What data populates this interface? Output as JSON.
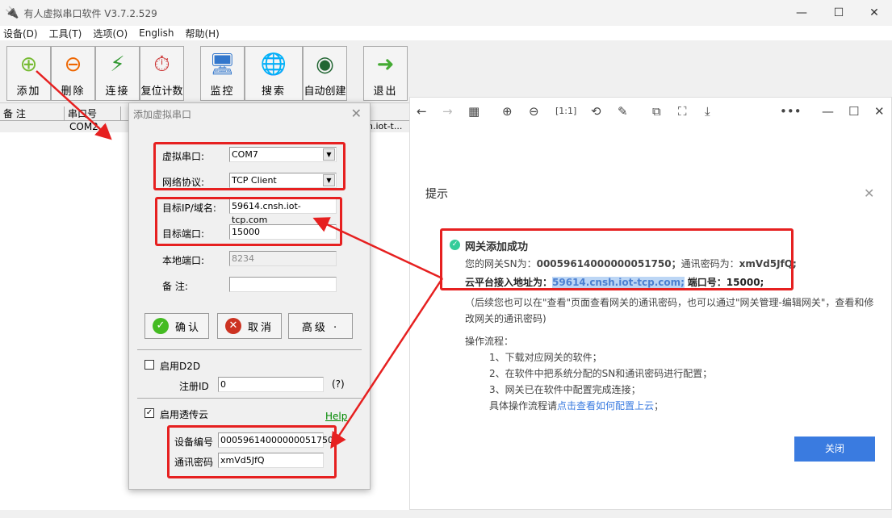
{
  "app": {
    "title": "有人虚拟串口软件 V3.7.2.529",
    "menu": [
      "设备(D)",
      "工具(T)",
      "选项(O)",
      "English",
      "帮助(H)"
    ],
    "toolbar": [
      "添加",
      "删除",
      "连接",
      "复位计数",
      "监控",
      "搜索",
      "自动创建",
      "退出"
    ],
    "list_headers": [
      "备 注",
      "串口号"
    ],
    "row": {
      "port": "COM2",
      "host": "n.iot-t..."
    }
  },
  "dialog": {
    "title": "添加虚拟串口",
    "virtual_port_label": "虚拟串口:",
    "virtual_port": "COM7",
    "protocol_label": "网络协议:",
    "protocol": "TCP Client",
    "target_ip_label": "目标IP/域名:",
    "target_ip": "59614.cnsh.iot-tcp.com",
    "target_port_label": "目标端口:",
    "target_port": "15000",
    "local_port_label": "本地端口:",
    "local_port": "8234",
    "remark_label": "备 注:",
    "remark": "",
    "ok": "确认",
    "cancel": "取消",
    "advanced": "高级 ·",
    "d2d_label": "启用D2D",
    "d2d_checked": false,
    "reg_id_label": "注册ID",
    "reg_id": "0",
    "reg_help": "(?)",
    "cloud_label": "启用透传云",
    "cloud_checked": true,
    "help": "Help",
    "device_id_label": "设备编号",
    "device_id": "00059614000000051750",
    "password_label": "通讯密码",
    "password": "xmVd5JfQ"
  },
  "viewer": {
    "tip_title": "提示",
    "success": "网关添加成功",
    "line1_a": "您的网关SN为：",
    "line1_sn": "00059614000000051750；",
    "line1_b": "通讯密码为：",
    "line1_pw": "xmVd5JfQ;",
    "line2_a": "云平台接入地址为：",
    "line2_host": "59614.cnsh.iot-tcp.com;",
    "line2_b": "端口号：15000;",
    "note1": "（后续您也可以在\"查看\"页面查看网关的通讯密码，也可以通过\"网关管理-编辑网关\"，查看和修",
    "note2": "改网关的通讯密码)",
    "flow": "操作流程：",
    "steps": [
      "1、下载对应网关的软件；",
      "2、在软件中把系统分配的SN和通讯密码进行配置；",
      "3、网关已在软件中配置完成连接；"
    ],
    "detail": "具体操作流程请",
    "detail_link": "点击查看如何配置上云",
    "detail_end": "；",
    "close": "关闭"
  }
}
